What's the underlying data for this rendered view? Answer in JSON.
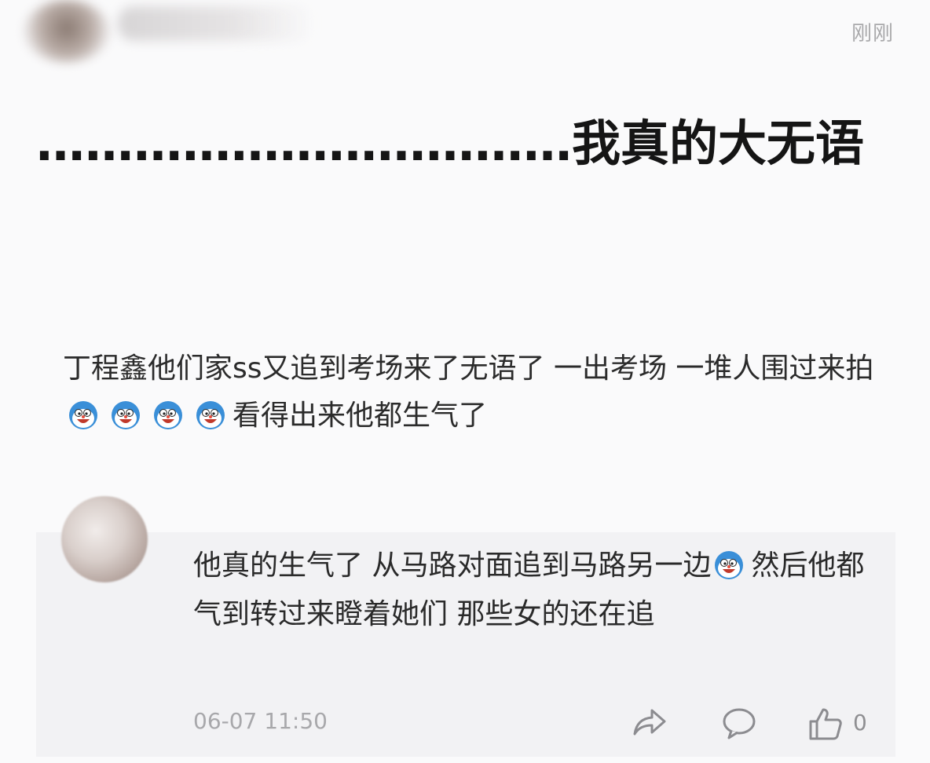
{
  "post": {
    "timestamp": "刚刚",
    "title": "……………………………我真的大无语",
    "body_before_emoji": "丁程鑫他们家ss又追到考场来了无语了  一出考场  一堆人围过来拍",
    "emoji_icon": "angry-cartoon-face-emoji",
    "emoji_count": 4,
    "body_after_emoji": "看得出来他都生气了"
  },
  "reply": {
    "text_before_emoji": "他真的生气了  从马路对面追到马路另一边",
    "emoji_icon": "angry-cartoon-face-emoji",
    "text_after_emoji": "然后他都气到转过来瞪着她们  那些女的还在追",
    "time": "06-07 11:50",
    "like_count": "0"
  },
  "colors": {
    "background": "#fafafb",
    "reply_background": "#f2f2f4",
    "emoji_face": "#3a8fd8"
  }
}
